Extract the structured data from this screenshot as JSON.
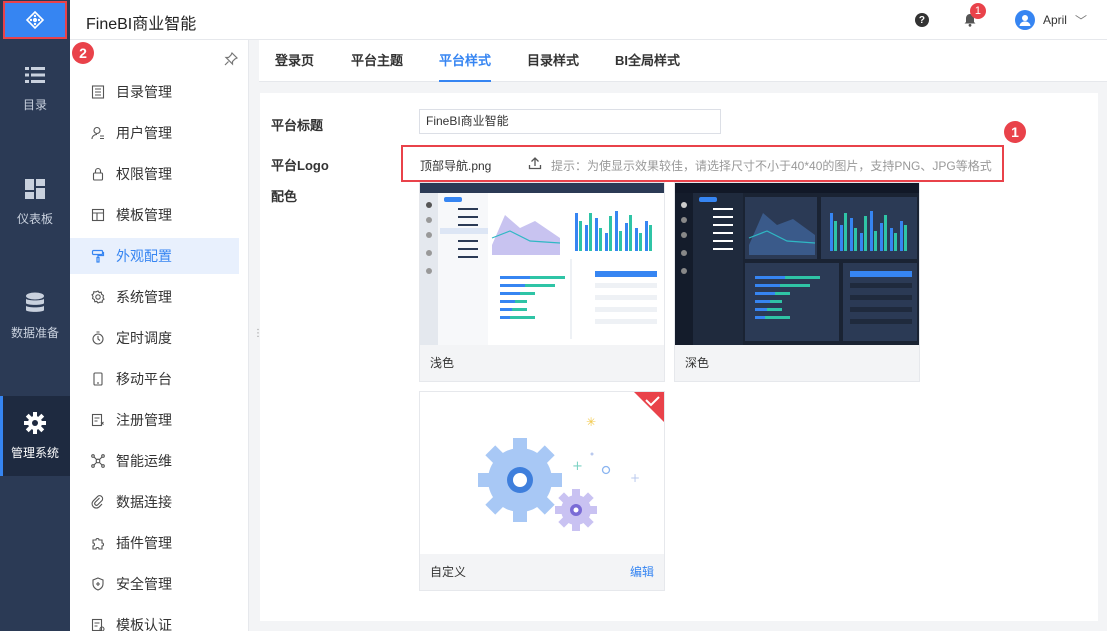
{
  "app": {
    "title": "FineBI商业智能"
  },
  "header": {
    "help_icon": "question-circle-icon",
    "notification_count": "1",
    "user_name": "April"
  },
  "annotations": {
    "step1": "1",
    "step2": "2"
  },
  "left_nav": [
    {
      "label": "目录",
      "icon": "list-icon"
    },
    {
      "label": "仪表板",
      "icon": "dashboard-icon"
    },
    {
      "label": "数据准备",
      "icon": "database-icon"
    },
    {
      "label": "管理系统",
      "icon": "gear-icon",
      "active": true
    }
  ],
  "sub_menu": [
    {
      "label": "目录管理",
      "icon": "catalog-icon"
    },
    {
      "label": "用户管理",
      "icon": "user-icon"
    },
    {
      "label": "权限管理",
      "icon": "lock-icon"
    },
    {
      "label": "模板管理",
      "icon": "template-icon"
    },
    {
      "label": "外观配置",
      "icon": "paint-icon",
      "active": true
    },
    {
      "label": "系统管理",
      "icon": "settings-icon"
    },
    {
      "label": "定时调度",
      "icon": "timer-icon"
    },
    {
      "label": "移动平台",
      "icon": "mobile-icon"
    },
    {
      "label": "注册管理",
      "icon": "register-icon"
    },
    {
      "label": "智能运维",
      "icon": "network-icon"
    },
    {
      "label": "数据连接",
      "icon": "link-icon"
    },
    {
      "label": "插件管理",
      "icon": "puzzle-icon"
    },
    {
      "label": "安全管理",
      "icon": "shield-icon"
    },
    {
      "label": "模板认证",
      "icon": "certify-icon"
    }
  ],
  "tabs": [
    {
      "label": "登录页"
    },
    {
      "label": "平台主题"
    },
    {
      "label": "平台样式",
      "active": true
    },
    {
      "label": "目录样式"
    },
    {
      "label": "BI全局样式"
    }
  ],
  "form": {
    "title_label": "平台标题",
    "title_value": "FineBI商业智能",
    "logo_label": "平台Logo",
    "logo_file": "顶部导航.png",
    "logo_hint": "提示：为使显示效果较佳，请选择尺寸不小于40*40的图片，支持PNG、JPG等格式",
    "color_label": "配色"
  },
  "themes": [
    {
      "label": "浅色",
      "style": "light"
    },
    {
      "label": "深色",
      "style": "dark"
    },
    {
      "label": "自定义",
      "style": "custom",
      "selected": true,
      "edit_label": "编辑"
    }
  ],
  "colors": {
    "accent": "#3685f2",
    "nav_bg": "#2b3a55",
    "highlight": "#e9424a"
  }
}
